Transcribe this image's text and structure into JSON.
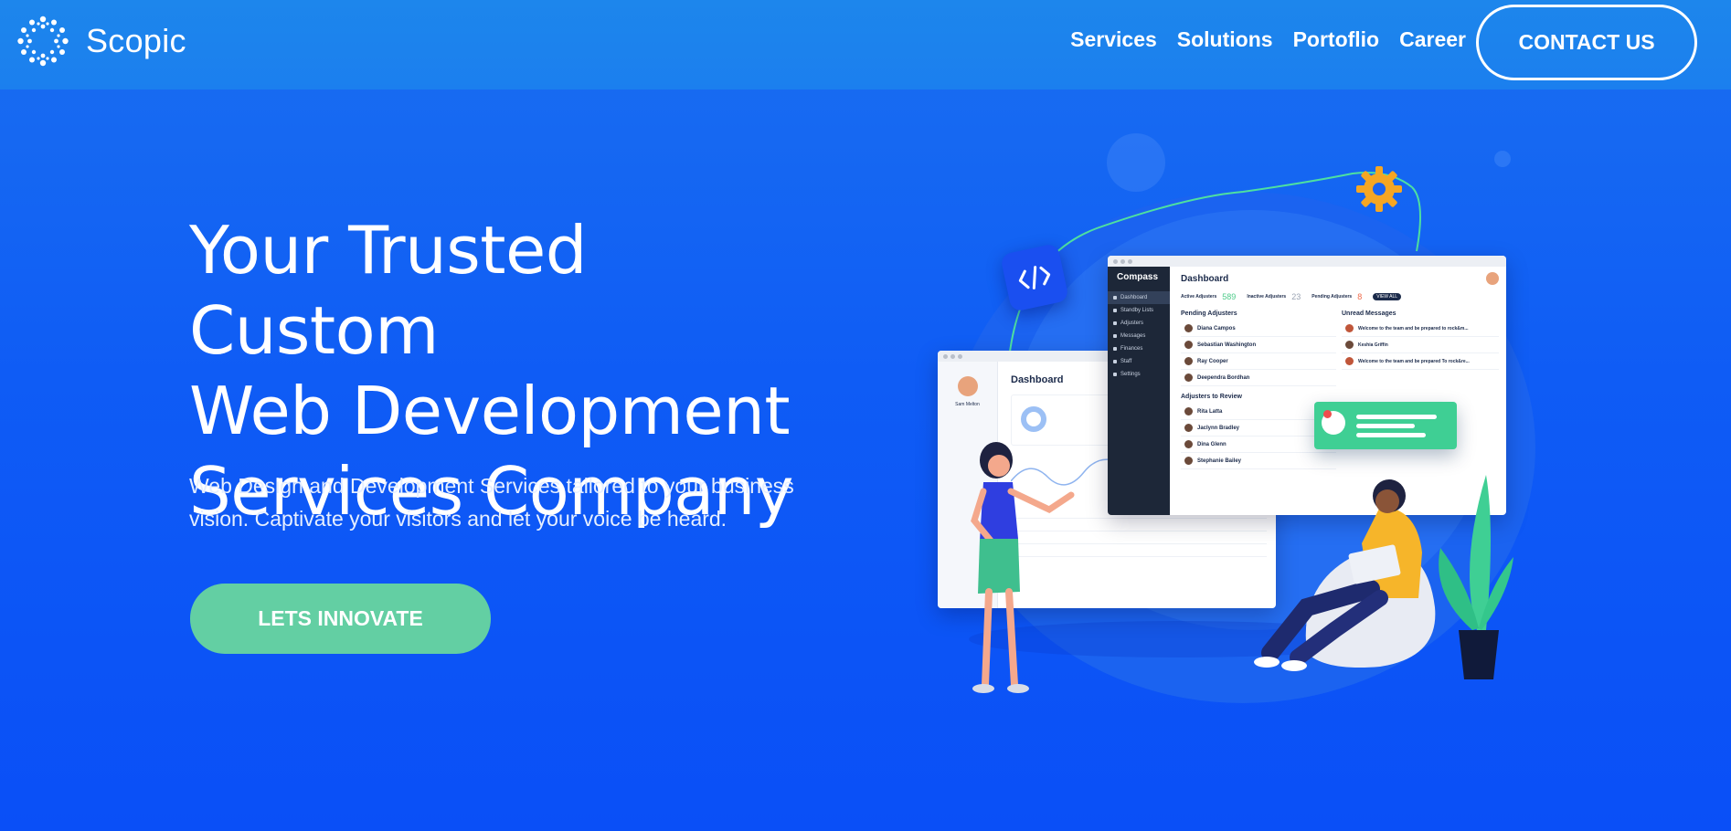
{
  "brand": {
    "name": "Scopic"
  },
  "nav": {
    "items": [
      "Services",
      "Solutions",
      "Portoflio",
      "Career"
    ],
    "contact_label": "CONTACT US"
  },
  "hero": {
    "title_lines": [
      "Your Trusted Custom",
      "Web Development",
      "Services Company"
    ],
    "subtitle_lines": [
      "Web Design and Development Services tailored to your business",
      "vision. Captivate your visitors and let your voice be heard."
    ],
    "cta_label": "LETS INNOVATE"
  },
  "illustration": {
    "main_window": {
      "app_name": "Compass",
      "title": "Dashboard",
      "stats": [
        {
          "label": "Active Adjusters",
          "value": "589"
        },
        {
          "label": "Inactive Adjusters",
          "value": "23"
        },
        {
          "label": "Pending Adjusters",
          "value": "8"
        }
      ],
      "view_all": "VIEW ALL",
      "sidebar": [
        "Dashboard",
        "Standby Lists",
        "Adjusters",
        "Messages",
        "Finances",
        "Staff",
        "Settings"
      ],
      "pending_heading": "Pending Adjusters",
      "pending": [
        "Diana Campos",
        "Sebastian Washington",
        "Ray Cooper",
        "Deependra Bordhan"
      ],
      "unread_heading": "Unread Messages",
      "messages": [
        "Welcome to the team and be prepared to rock&m...",
        "Keshia Griffin",
        "Welcome to the team and be prepared To rock&re..."
      ],
      "review_heading": "Adjusters to Review",
      "review": [
        "Rita Latta",
        "Jaclynn Bradley",
        "Dina Glenn",
        "Stephanie Bailey"
      ]
    },
    "back_window": {
      "title": "Dashboard",
      "user_name": "Sam Melton"
    },
    "colors": {
      "accent_green": "#63cfa3",
      "gear": "#f6a623",
      "code_badge": "#1a4ff0",
      "sidebar_dark": "#1d2738"
    },
    "icons": [
      "code-icon",
      "gear-icon"
    ]
  }
}
